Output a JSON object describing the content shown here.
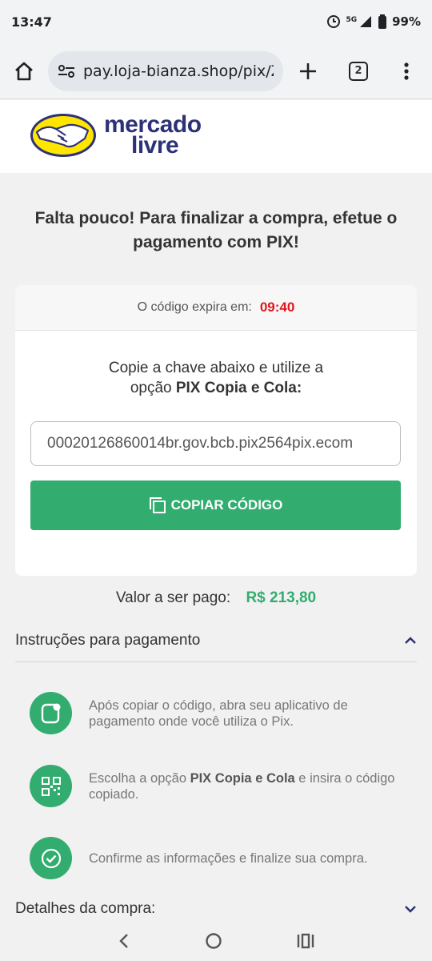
{
  "status_bar": {
    "time": "13:47",
    "network": "5G",
    "battery": "99%"
  },
  "browser": {
    "url": "pay.loja-bianza.shop/pix/Zb",
    "tab_count": "2"
  },
  "logo": {
    "line1": "mercado",
    "line2": "livre"
  },
  "headline": "Falta pouco! Para finalizar a compra, efetue o pagamento com PIX!",
  "card": {
    "expires_label": "O código expira em:",
    "timer": "09:40",
    "instruction_line1": "Copie a chave abaixo e utilize a",
    "instruction_prefix": "opção ",
    "instruction_bold": "PIX Copia e Cola:",
    "pix_code": "00020126860014br.gov.bcb.pix2564pix.ecom",
    "copy_button": "COPIAR CÓDIGO"
  },
  "amount": {
    "label": "Valor a ser pago:",
    "value": "R$ 213,80"
  },
  "instructions": {
    "title": "Instruções para pagamento",
    "steps": [
      {
        "text": "Após copiar o código, abra seu aplicativo de pagamento onde você utiliza o Pix.",
        "icon": "phone-app-icon"
      },
      {
        "prefix": "Escolha a opção ",
        "bold": "PIX Copia e Cola",
        "suffix": " e insira o código copiado.",
        "icon": "qr-code-icon"
      },
      {
        "text": "Confirme as informações e finalize sua compra.",
        "icon": "check-circle-icon"
      }
    ]
  },
  "details": {
    "title": "Detalhes da compra:"
  },
  "colors": {
    "accent_green": "#32ad6f",
    "timer_red": "#e0161d",
    "logo_blue": "#2d3277",
    "logo_yellow": "#ffe600"
  }
}
